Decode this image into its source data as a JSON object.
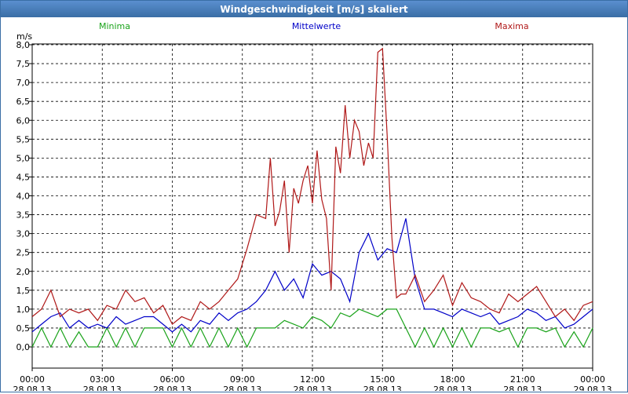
{
  "window": {
    "title": "Windgeschwindigkeit [m/s] skaliert"
  },
  "chart_data": {
    "type": "line",
    "ylabel": "m/s",
    "ylim": [
      0,
      8
    ],
    "yticks": [
      "0,0",
      "0,5",
      "1,0",
      "1,5",
      "2,0",
      "2,5",
      "3,0",
      "3,5",
      "4,0",
      "4,5",
      "5,0",
      "5,5",
      "6,0",
      "6,5",
      "7,0",
      "7,5",
      "8,0"
    ],
    "xlim_hours": [
      0,
      24
    ],
    "xticks": [
      {
        "time": "00:00",
        "date": "28.08.13"
      },
      {
        "time": "03:00",
        "date": "28.08.13"
      },
      {
        "time": "06:00",
        "date": "28.08.13"
      },
      {
        "time": "09:00",
        "date": "28.08.13"
      },
      {
        "time": "12:00",
        "date": "28.08.13"
      },
      {
        "time": "15:00",
        "date": "28.08.13"
      },
      {
        "time": "18:00",
        "date": "28.08.13"
      },
      {
        "time": "21:00",
        "date": "28.08.13"
      },
      {
        "time": "00:00",
        "date": "29.08.13"
      }
    ],
    "grid": true,
    "series": [
      {
        "name": "Minima",
        "color": "#1aa31a",
        "x": [
          0,
          0.4,
          0.8,
          1.2,
          1.6,
          2.0,
          2.4,
          2.8,
          3.2,
          3.6,
          4.0,
          4.4,
          4.8,
          5.2,
          5.6,
          6.0,
          6.4,
          6.8,
          7.2,
          7.6,
          8.0,
          8.4,
          8.8,
          9.2,
          9.6,
          10.0,
          10.4,
          10.8,
          11.2,
          11.6,
          12.0,
          12.4,
          12.8,
          13.2,
          13.6,
          14.0,
          14.4,
          14.8,
          15.2,
          15.6,
          16.0,
          16.4,
          16.8,
          17.2,
          17.6,
          18.0,
          18.4,
          18.8,
          19.2,
          19.6,
          20.0,
          20.4,
          20.8,
          21.2,
          21.6,
          22.0,
          22.4,
          22.8,
          23.2,
          23.6,
          24.0
        ],
        "values": [
          0.0,
          0.5,
          0.0,
          0.5,
          0.0,
          0.4,
          0.0,
          0.0,
          0.5,
          0.0,
          0.5,
          0.0,
          0.5,
          0.5,
          0.5,
          0.0,
          0.5,
          0.0,
          0.5,
          0.0,
          0.5,
          0.0,
          0.5,
          0.0,
          0.5,
          0.5,
          0.5,
          0.7,
          0.6,
          0.5,
          0.8,
          0.7,
          0.5,
          0.9,
          0.8,
          1.0,
          0.9,
          0.8,
          1.0,
          1.0,
          0.5,
          0.0,
          0.5,
          0.0,
          0.5,
          0.0,
          0.5,
          0.0,
          0.5,
          0.5,
          0.4,
          0.5,
          0.0,
          0.5,
          0.5,
          0.4,
          0.5,
          0.0,
          0.4,
          0.0,
          0.5
        ]
      },
      {
        "name": "Mittelwerte",
        "color": "#0000c8",
        "x": [
          0,
          0.4,
          0.8,
          1.2,
          1.6,
          2.0,
          2.4,
          2.8,
          3.2,
          3.6,
          4.0,
          4.4,
          4.8,
          5.2,
          5.6,
          6.0,
          6.4,
          6.8,
          7.2,
          7.6,
          8.0,
          8.4,
          8.8,
          9.2,
          9.6,
          10.0,
          10.4,
          10.8,
          11.2,
          11.6,
          12.0,
          12.4,
          12.8,
          13.2,
          13.6,
          14.0,
          14.4,
          14.8,
          15.2,
          15.6,
          16.0,
          16.4,
          16.8,
          17.2,
          17.6,
          18.0,
          18.4,
          18.8,
          19.2,
          19.6,
          20.0,
          20.4,
          20.8,
          21.2,
          21.6,
          22.0,
          22.4,
          22.8,
          23.2,
          23.6,
          24.0
        ],
        "values": [
          0.4,
          0.6,
          0.8,
          0.9,
          0.5,
          0.7,
          0.5,
          0.6,
          0.5,
          0.8,
          0.6,
          0.7,
          0.8,
          0.8,
          0.6,
          0.4,
          0.6,
          0.4,
          0.7,
          0.6,
          0.9,
          0.7,
          0.9,
          1.0,
          1.2,
          1.5,
          2.0,
          1.5,
          1.8,
          1.3,
          2.2,
          1.9,
          2.0,
          1.8,
          1.2,
          2.5,
          3.0,
          2.3,
          2.6,
          2.5,
          3.4,
          1.8,
          1.0,
          1.0,
          0.9,
          0.8,
          1.0,
          0.9,
          0.8,
          0.9,
          0.6,
          0.7,
          0.8,
          1.0,
          0.9,
          0.7,
          0.8,
          0.5,
          0.6,
          0.8,
          1.0
        ]
      },
      {
        "name": "Maxima",
        "color": "#b01818",
        "x": [
          0,
          0.4,
          0.8,
          1.2,
          1.6,
          2.0,
          2.4,
          2.8,
          3.2,
          3.6,
          4.0,
          4.4,
          4.8,
          5.2,
          5.6,
          6.0,
          6.4,
          6.8,
          7.2,
          7.6,
          8.0,
          8.4,
          8.8,
          9.2,
          9.6,
          10.0,
          10.2,
          10.4,
          10.6,
          10.8,
          11.0,
          11.2,
          11.4,
          11.6,
          11.8,
          12.0,
          12.2,
          12.4,
          12.6,
          12.8,
          13.0,
          13.2,
          13.4,
          13.6,
          13.8,
          14.0,
          14.2,
          14.4,
          14.6,
          14.8,
          15.0,
          15.2,
          15.4,
          15.6,
          15.8,
          16.0,
          16.4,
          16.8,
          17.2,
          17.6,
          18.0,
          18.4,
          18.8,
          19.2,
          19.6,
          20.0,
          20.4,
          20.8,
          21.2,
          21.6,
          22.0,
          22.4,
          22.8,
          23.2,
          23.6,
          24.0
        ],
        "values": [
          0.8,
          1.0,
          1.5,
          0.8,
          1.0,
          0.9,
          1.0,
          0.7,
          1.1,
          1.0,
          1.5,
          1.2,
          1.3,
          0.9,
          1.1,
          0.6,
          0.8,
          0.7,
          1.2,
          1.0,
          1.2,
          1.5,
          1.8,
          2.6,
          3.5,
          3.4,
          5.0,
          3.2,
          3.6,
          4.4,
          2.5,
          4.2,
          3.8,
          4.4,
          4.8,
          3.8,
          5.2,
          3.9,
          3.4,
          1.5,
          5.3,
          4.6,
          6.4,
          5.0,
          6.0,
          5.7,
          4.8,
          5.4,
          5.0,
          7.8,
          7.9,
          5.6,
          2.9,
          1.3,
          1.4,
          1.4,
          1.9,
          1.2,
          1.5,
          1.9,
          1.1,
          1.7,
          1.3,
          1.2,
          1.0,
          0.9,
          1.4,
          1.2,
          1.4,
          1.6,
          1.2,
          0.8,
          1.0,
          0.7,
          1.1,
          1.2
        ]
      }
    ]
  }
}
